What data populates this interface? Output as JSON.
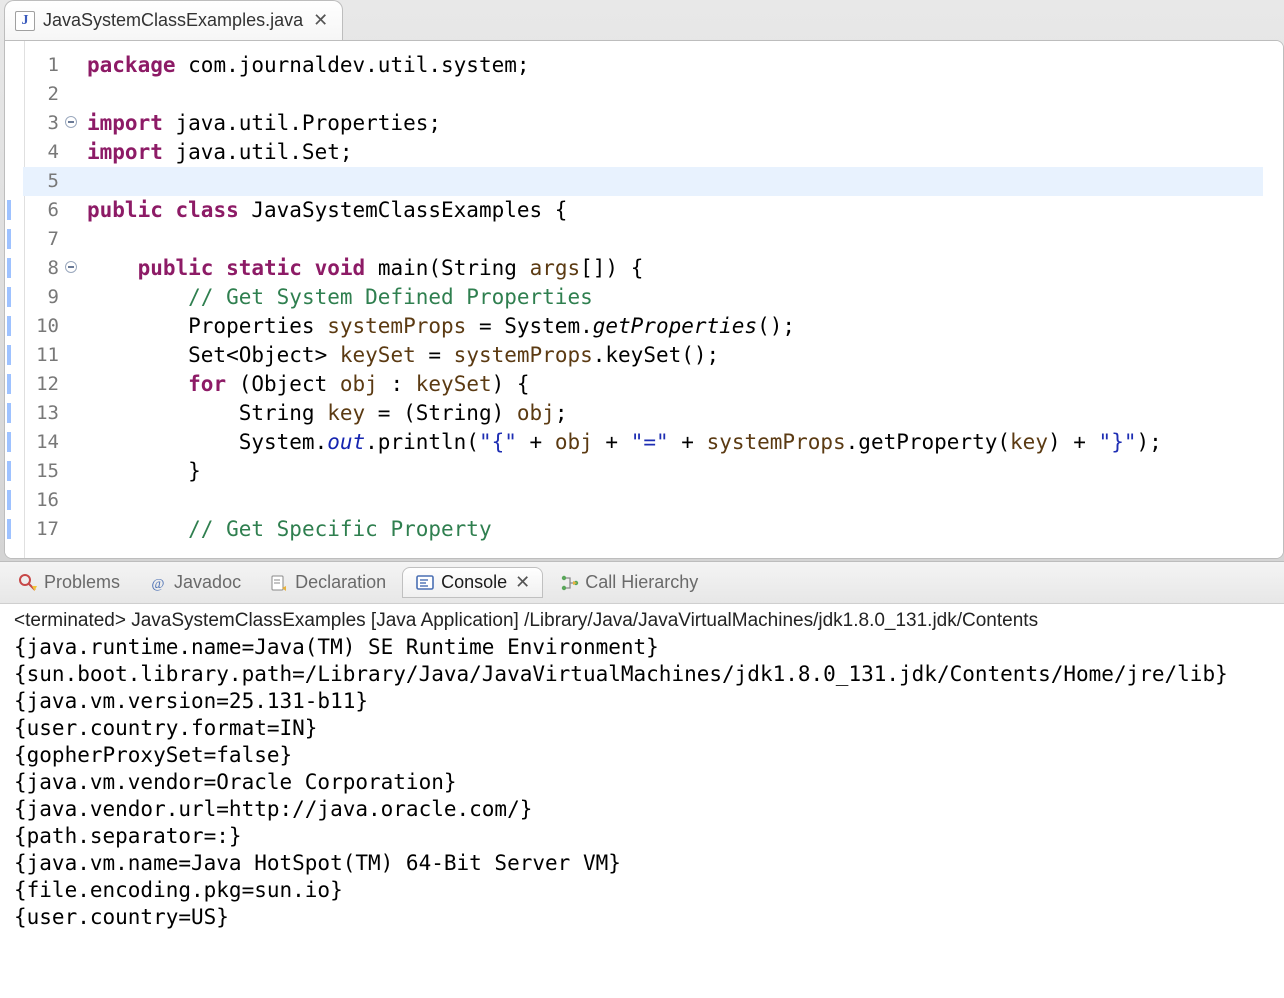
{
  "editor": {
    "tab_filename": "JavaSystemClassExamples.java",
    "tab_close": "✕",
    "lines": [
      {
        "n": "1",
        "fold": "",
        "sel": "",
        "html": "<span class='kw'>package</span> com.journaldev.util.system;"
      },
      {
        "n": "2",
        "fold": "",
        "sel": "",
        "html": ""
      },
      {
        "n": "3",
        "fold": "yes",
        "sel": "",
        "html": "<span class='kw'>import</span> java.util.Properties;"
      },
      {
        "n": "4",
        "fold": "",
        "sel": "",
        "html": "<span class='kw'>import</span> java.util.Set;"
      },
      {
        "n": "5",
        "fold": "",
        "sel": "",
        "current": true,
        "html": ""
      },
      {
        "n": "6",
        "fold": "",
        "sel": "y",
        "html": "<span class='kw'>public</span> <span class='kw'>class</span> JavaSystemClassExamples {"
      },
      {
        "n": "7",
        "fold": "",
        "sel": "y",
        "html": ""
      },
      {
        "n": "8",
        "fold": "yes",
        "sel": "y",
        "html": "    <span class='kw'>public</span> <span class='kw'>static</span> <span class='kw'>void</span> main(String <span class='var'>args</span>[]) {"
      },
      {
        "n": "9",
        "fold": "",
        "sel": "y",
        "html": "        <span class='cmnt'>// Get System Defined Properties</span>"
      },
      {
        "n": "10",
        "fold": "",
        "sel": "y",
        "html": "        Properties <span class='var'>systemProps</span> = System.<span class='ital'>getProperties</span>();"
      },
      {
        "n": "11",
        "fold": "",
        "sel": "y",
        "html": "        Set&lt;Object&gt; <span class='var'>keySet</span> = <span class='var'>systemProps</span>.keySet();"
      },
      {
        "n": "12",
        "fold": "",
        "sel": "y",
        "html": "        <span class='kw'>for</span> (Object <span class='var'>obj</span> : <span class='var'>keySet</span>) {"
      },
      {
        "n": "13",
        "fold": "",
        "sel": "y",
        "html": "            String <span class='var'>key</span> = (String) <span class='var'>obj</span>;"
      },
      {
        "n": "14",
        "fold": "",
        "sel": "y",
        "html": "            System.<span class='fld'>out</span>.println(<span class='str'>\"{\"</span> + <span class='var'>obj</span> + <span class='str'>\"=\"</span> + <span class='var'>systemProps</span>.getProperty(<span class='var'>key</span>) + <span class='str'>\"}\"</span>);"
      },
      {
        "n": "15",
        "fold": "",
        "sel": "y",
        "html": "        }"
      },
      {
        "n": "16",
        "fold": "",
        "sel": "y",
        "html": ""
      },
      {
        "n": "17",
        "fold": "",
        "sel": "y",
        "html": "        <span class='cmnt'>// Get Specific Property</span>"
      }
    ]
  },
  "views": {
    "tabs": [
      {
        "id": "problems",
        "label": "Problems",
        "active": false
      },
      {
        "id": "javadoc",
        "label": "Javadoc",
        "active": false
      },
      {
        "id": "declaration",
        "label": "Declaration",
        "active": false
      },
      {
        "id": "console",
        "label": "Console",
        "active": true
      },
      {
        "id": "callhierarchy",
        "label": "Call Hierarchy",
        "active": false
      }
    ],
    "close": "✕"
  },
  "console": {
    "status": "<terminated> JavaSystemClassExamples [Java Application] /Library/Java/JavaVirtualMachines/jdk1.8.0_131.jdk/Contents",
    "output": [
      "{java.runtime.name=Java(TM) SE Runtime Environment}",
      "{sun.boot.library.path=/Library/Java/JavaVirtualMachines/jdk1.8.0_131.jdk/Contents/Home/jre/lib}",
      "{java.vm.version=25.131-b11}",
      "{user.country.format=IN}",
      "{gopherProxySet=false}",
      "{java.vm.vendor=Oracle Corporation}",
      "{java.vendor.url=http://java.oracle.com/}",
      "{path.separator=:}",
      "{java.vm.name=Java HotSpot(TM) 64-Bit Server VM}",
      "{file.encoding.pkg=sun.io}",
      "{user.country=US}"
    ]
  }
}
